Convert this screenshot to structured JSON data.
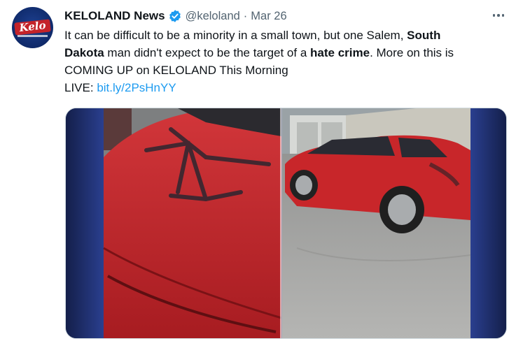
{
  "account": {
    "name": "KELOLAND News",
    "handle": "@keloland",
    "separator": "·",
    "date": "Mar 26",
    "avatar_text": "Kelo",
    "verified_icon": "verified-badge-icon"
  },
  "tweet": {
    "line1_a": "It can be difficult to be a minority in a small town, but one Salem, ",
    "line1_bold": "South",
    "line2_bold_a": "Dakota",
    "line2_a": " man didn't expect to be the target of a ",
    "line2_bold_b": "hate crime",
    "line2_b": ". More on this is",
    "line3": "COMING UP on KELOLAND This Morning",
    "live_label": "LIVE: ",
    "live_link": "bit.ly/2PsHnYY"
  },
  "media": {
    "description_icon": "photo-icon"
  },
  "colors": {
    "link": "#1d9bf0",
    "secondary_text": "#536471",
    "media_frame": "#182859",
    "car_red": "#c8262a"
  }
}
